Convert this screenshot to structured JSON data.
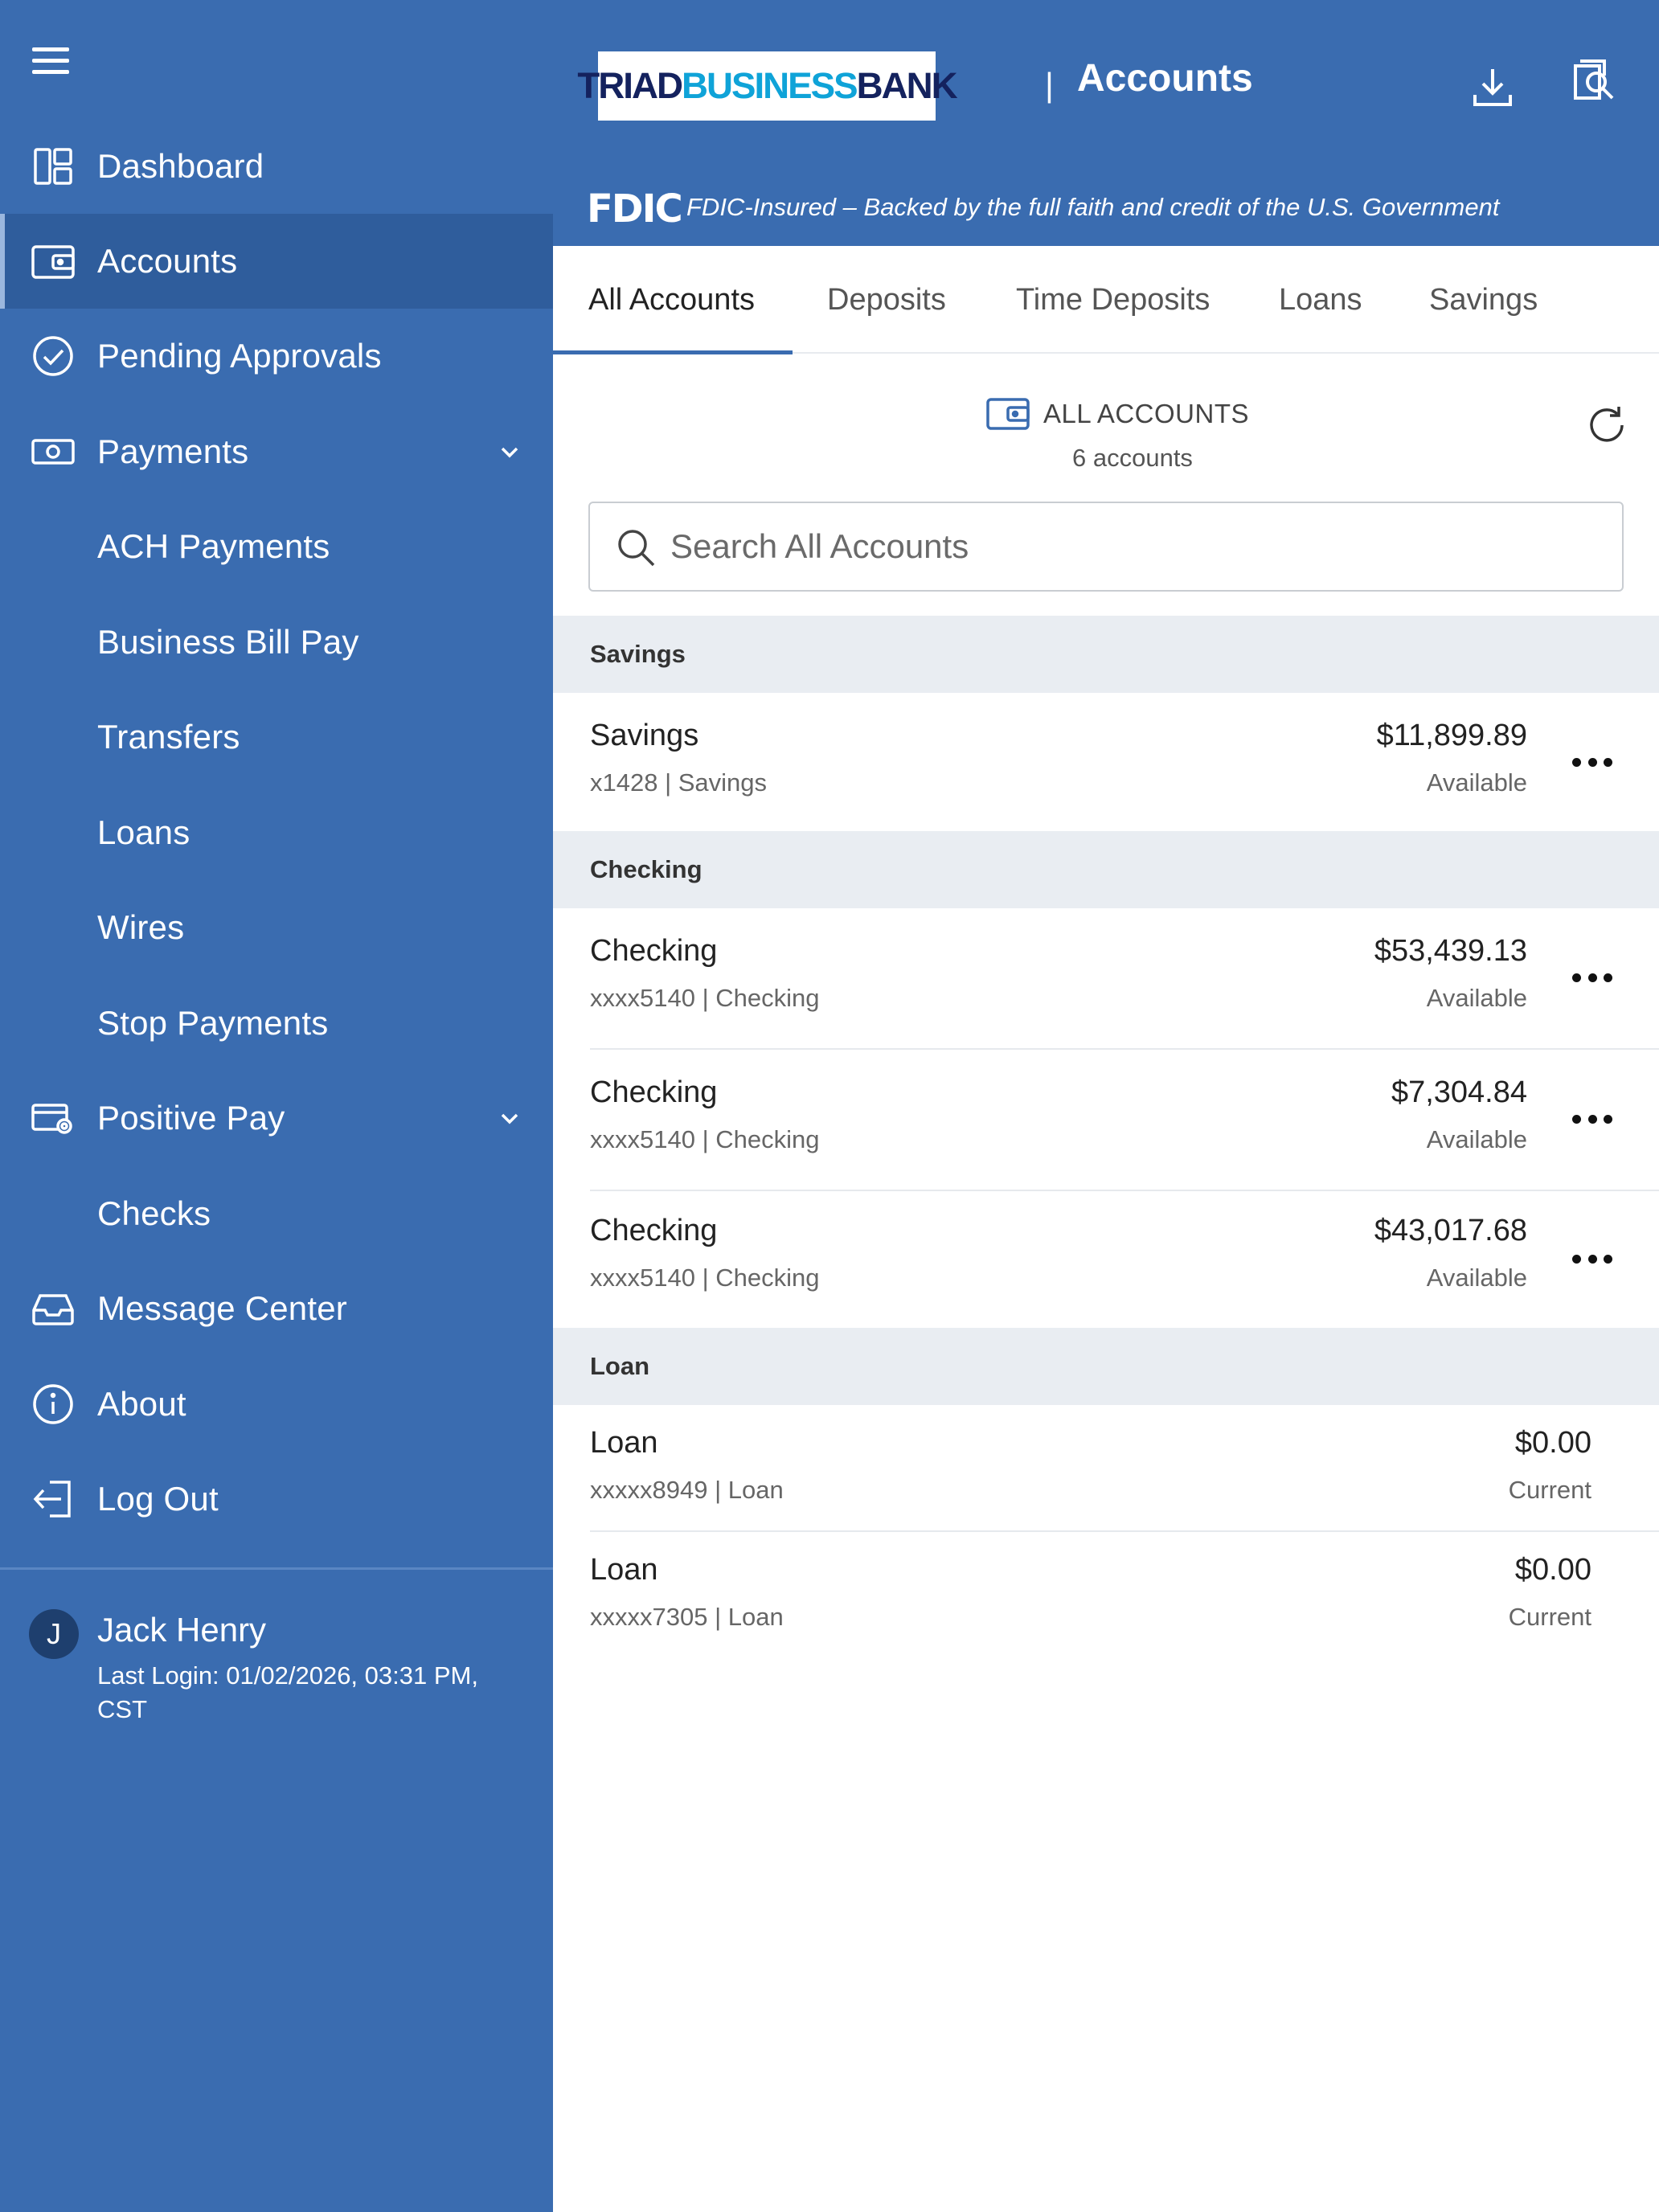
{
  "header": {
    "logo": {
      "part1": "TRIAD",
      "part2": "BUSINESS",
      "part3": "BANK"
    },
    "divider": "|",
    "title": "Accounts",
    "icons": [
      "download-icon",
      "document-search-icon"
    ],
    "fdic_mark": "FDIC",
    "fdic_text": "FDIC-Insured – Backed by the full faith and credit of the U.S. Government"
  },
  "sidebar": {
    "items": [
      {
        "label": "Dashboard",
        "icon": "dashboard-icon"
      },
      {
        "label": "Accounts",
        "icon": "wallet-icon",
        "active": true
      },
      {
        "label": "Pending Approvals",
        "icon": "check-circle-icon"
      },
      {
        "label": "Payments",
        "icon": "money-icon",
        "expandable": true
      },
      {
        "label": "ACH Payments"
      },
      {
        "label": "Business Bill Pay"
      },
      {
        "label": "Transfers"
      },
      {
        "label": "Loans"
      },
      {
        "label": "Wires"
      },
      {
        "label": "Stop Payments"
      },
      {
        "label": "Positive Pay",
        "icon": "card-settings-icon",
        "expandable": true
      },
      {
        "label": "Checks"
      },
      {
        "label": "Message Center",
        "icon": "inbox-icon"
      },
      {
        "label": "About",
        "icon": "info-icon"
      },
      {
        "label": "Log Out",
        "icon": "logout-icon"
      }
    ],
    "user": {
      "initial": "J",
      "name": "Jack Henry",
      "last_login": "Last Login: 01/02/2026, 03:31 PM, CST"
    }
  },
  "tabs": [
    "All Accounts",
    "Deposits",
    "Time Deposits",
    "Loans",
    "Savings"
  ],
  "active_tab": "All Accounts",
  "summary": {
    "title": "ALL ACCOUNTS",
    "count": "6 accounts"
  },
  "search": {
    "placeholder": "Search All Accounts",
    "value": ""
  },
  "groups": [
    {
      "name": "Savings",
      "accounts": [
        {
          "name": "Savings",
          "number": "x1428 | Savings",
          "amount": "$11,899.89",
          "status": "Available"
        }
      ]
    },
    {
      "name": "Checking",
      "accounts": [
        {
          "name": "Checking",
          "number": "xxxx5140 | Checking",
          "amount": "$53,439.13",
          "status": "Available"
        },
        {
          "name": "Checking",
          "number": "xxxx5140 | Checking",
          "amount": "$7,304.84",
          "status": "Available"
        },
        {
          "name": "Checking",
          "number": "xxxx5140 | Checking",
          "amount": "$43,017.68",
          "status": "Available"
        }
      ]
    },
    {
      "name": "Loan",
      "accounts": [
        {
          "name": "Loan",
          "number": "xxxxx8949 | Loan",
          "amount": "$0.00",
          "status": "Current"
        },
        {
          "name": "Loan",
          "number": "xxxxx7305 | Loan",
          "amount": "$0.00",
          "status": "Current"
        }
      ]
    }
  ],
  "colors": {
    "brand_blue": "#3a6cb0",
    "group_bg": "#e9edf2",
    "logo_navy": "#14225e",
    "logo_cyan": "#0fa3d8"
  }
}
